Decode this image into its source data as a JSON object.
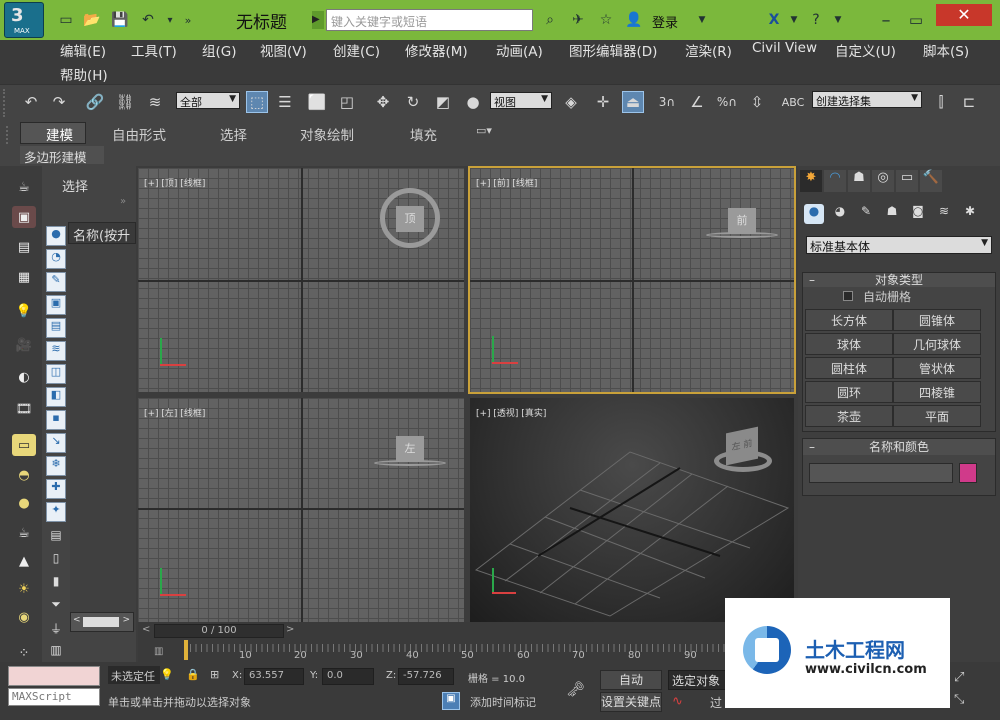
{
  "title_bar": {
    "title": "无标题",
    "search_placeholder": "键入关键字或短语",
    "login": "登录",
    "app_badge": "MAX"
  },
  "menu": {
    "row1": [
      "编辑(E)",
      "工具(T)",
      "组(G)",
      "视图(V)",
      "创建(C)",
      "修改器(M)",
      "动画(A)",
      "图形编辑器(D)",
      "渲染(R)",
      "Civil View",
      "自定义(U)",
      "脚本(S)"
    ],
    "row2": [
      "帮助(H)"
    ]
  },
  "toolbar": {
    "filter_value": "全部",
    "ref_coord_value": "视图",
    "selection_set_placeholder": "创建选择集"
  },
  "ribbon": {
    "tabs": [
      "建模",
      "自由形式",
      "选择",
      "对象绘制",
      "填充"
    ],
    "sub_tab": "多边形建模"
  },
  "scene_explorer": {
    "title": "选择",
    "column_header": "名称(按升"
  },
  "viewports": {
    "top": "[+] [顶] [线框]",
    "front": "[+] [前] [线框]",
    "left": "[+] [左] [线框]",
    "perspective": "[+] [透视] [真实]",
    "cube_labels": {
      "top": "顶",
      "front": "前",
      "left": "左",
      "perspective": "左 前"
    }
  },
  "command_panel": {
    "category_value": "标准基本体",
    "object_type_title": "对象类型",
    "auto_grid_label": "自动栅格",
    "buttons": [
      "长方体",
      "圆锥体",
      "球体",
      "几何球体",
      "圆柱体",
      "管状体",
      "圆环",
      "四棱锥",
      "茶壶",
      "平面"
    ],
    "name_color_title": "名称和颜色",
    "color_swatch": "#d03a8a"
  },
  "timeline": {
    "frame_counter": "0 / 100",
    "ticks": [
      "10",
      "20",
      "30",
      "40",
      "50",
      "60",
      "70",
      "80",
      "90"
    ]
  },
  "status": {
    "maxscript": "MAXScript",
    "selection_status": "未选定任",
    "prompt": "单击或单击并拖动以选择对象",
    "x_label": "X:",
    "x_value": "63.557",
    "y_label": "Y:",
    "y_value": "0.0",
    "z_label": "Z:",
    "z_value": "-57.726",
    "grid_label": "栅格 = 10.0",
    "add_time_tag": "添加时间标记",
    "auto_key": "自动",
    "selected_object": "选定对象",
    "set_key": "设置关键点",
    "filter_partial": "过"
  },
  "watermark": {
    "site_name": "土木工程网",
    "url": "www.civilcn.com"
  }
}
